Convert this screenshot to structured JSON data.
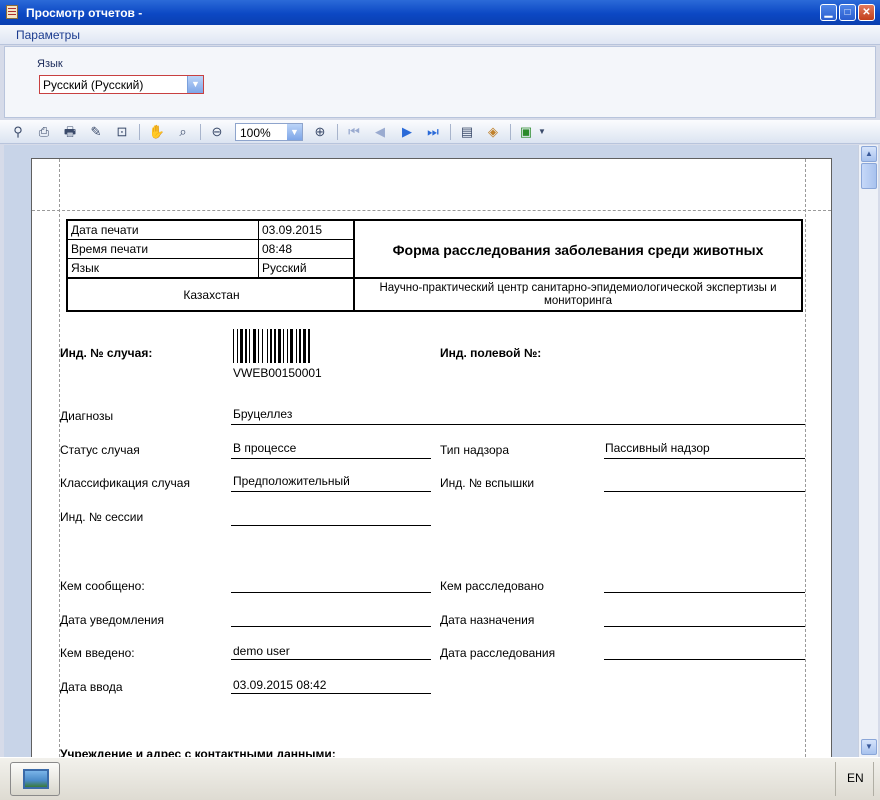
{
  "window": {
    "title": "Просмотр отчетов -"
  },
  "menu": {
    "parameters": "Параметры"
  },
  "params": {
    "language_label": "Язык",
    "language_value": "Русский (Русский)"
  },
  "toolbar": {
    "zoom": "100%"
  },
  "report": {
    "print_date_label": "Дата печати",
    "print_date": "03.09.2015",
    "print_time_label": "Время печати",
    "print_time": "08:48",
    "language_label": "Язык",
    "language": "Русский",
    "country": "Казахстан",
    "form_title": "Форма расследования заболевания среди животных",
    "organization": "Научно-практический центр санитарно-эпидемиологической экспертизы и мониторинга",
    "case_id_label": "Инд. № случая:",
    "barcode_text": "VWEB00150001",
    "field_id_label": "Инд. полевой №:",
    "diagnosis_label": "Диагнозы",
    "diagnosis": "Бруцеллез",
    "case_status_label": "Статус случая",
    "case_status": "В процессе",
    "surveillance_type_label": "Тип надзора",
    "surveillance_type": "Пассивный надзор",
    "case_classification_label": "Классификация случая",
    "case_classification": "Предположительный",
    "outbreak_id_label": "Инд. № вспышки",
    "session_id_label": "Инд. № сессии",
    "reported_by_label": "Кем сообщено:",
    "investigated_by_label": "Кем расследовано",
    "notification_date_label": "Дата уведомления",
    "assignment_date_label": "Дата назначения",
    "entered_by_label": "Кем введено:",
    "entered_by": "demo user",
    "investigation_date_label": "Дата расследования",
    "entry_date_label": "Дата ввода",
    "entry_date": "03.09.2015 08:42",
    "institution_label": "Учреждение и адрес с контактными данными:"
  },
  "taskbar": {
    "language": "EN"
  }
}
